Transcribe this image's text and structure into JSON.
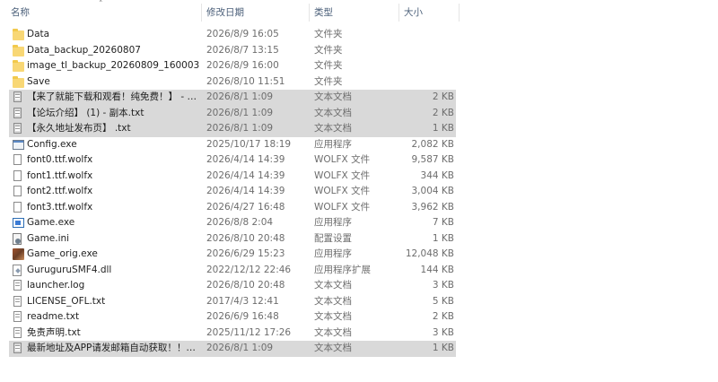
{
  "columns": {
    "name": "名称",
    "date": "修改日期",
    "type": "类型",
    "size": "大小"
  },
  "files": [
    {
      "name": "Data",
      "date": "2026/8/9 16:05",
      "type": "文件夹",
      "size": "",
      "icon": "folder-icon",
      "selected": false
    },
    {
      "name": "Data_backup_20260807",
      "date": "2026/8/7 13:15",
      "type": "文件夹",
      "size": "",
      "icon": "folder-icon",
      "selected": false
    },
    {
      "name": "image_tl_backup_20260809_160003",
      "date": "2026/8/9 16:00",
      "type": "文件夹",
      "size": "",
      "icon": "folder-icon",
      "selected": false
    },
    {
      "name": "Save",
      "date": "2026/8/10 11:51",
      "type": "文件夹",
      "size": "",
      "icon": "folder-icon",
      "selected": false
    },
    {
      "name": "【来了就能下载和观看！纯免费！】 - 副...",
      "date": "2026/8/1 1:09",
      "type": "文本文档",
      "size": "2 KB",
      "icon": "text-document-icon",
      "selected": true
    },
    {
      "name": "【论坛介绍】 (1) - 副本.txt",
      "date": "2026/8/1 1:09",
      "type": "文本文档",
      "size": "2 KB",
      "icon": "text-document-icon",
      "selected": true
    },
    {
      "name": "【永久地址发布页】 .txt",
      "date": "2026/8/1 1:09",
      "type": "文本文档",
      "size": "1 KB",
      "icon": "text-document-icon",
      "selected": true
    },
    {
      "name": "Config.exe",
      "date": "2025/10/17 18:19",
      "type": "应用程序",
      "size": "2,082 KB",
      "icon": "application-icon",
      "selected": false
    },
    {
      "name": "font0.ttf.wolfx",
      "date": "2026/4/14 14:39",
      "type": "WOLFX 文件",
      "size": "9,587 KB",
      "icon": "blank-file-icon",
      "selected": false
    },
    {
      "name": "font1.ttf.wolfx",
      "date": "2026/4/14 14:39",
      "type": "WOLFX 文件",
      "size": "344 KB",
      "icon": "blank-file-icon",
      "selected": false
    },
    {
      "name": "font2.ttf.wolfx",
      "date": "2026/4/14 14:39",
      "type": "WOLFX 文件",
      "size": "3,004 KB",
      "icon": "blank-file-icon",
      "selected": false
    },
    {
      "name": "font3.ttf.wolfx",
      "date": "2026/4/27 16:48",
      "type": "WOLFX 文件",
      "size": "3,962 KB",
      "icon": "blank-file-icon",
      "selected": false
    },
    {
      "name": "Game.exe",
      "date": "2026/8/8 2:04",
      "type": "应用程序",
      "size": "7 KB",
      "icon": "game-app-icon",
      "selected": false
    },
    {
      "name": "Game.ini",
      "date": "2026/8/10 20:48",
      "type": "配置设置",
      "size": "1 KB",
      "icon": "settings-file-icon",
      "selected": false
    },
    {
      "name": "Game_orig.exe",
      "date": "2026/6/29 15:23",
      "type": "应用程序",
      "size": "12,048 KB",
      "icon": "image-app-icon",
      "selected": false
    },
    {
      "name": "GuruguruSMF4.dll",
      "date": "2022/12/12 22:46",
      "type": "应用程序扩展",
      "size": "144 KB",
      "icon": "dll-file-icon",
      "selected": false
    },
    {
      "name": "launcher.log",
      "date": "2026/8/10 20:48",
      "type": "文本文档",
      "size": "3 KB",
      "icon": "text-document-icon",
      "selected": false
    },
    {
      "name": "LICENSE_OFL.txt",
      "date": "2017/4/3 12:41",
      "type": "文本文档",
      "size": "5 KB",
      "icon": "text-document-icon",
      "selected": false
    },
    {
      "name": "readme.txt",
      "date": "2026/6/9 16:48",
      "type": "文本文档",
      "size": "2 KB",
      "icon": "text-document-icon",
      "selected": false
    },
    {
      "name": "免责声明.txt",
      "date": "2025/11/12 17:26",
      "type": "文本文档",
      "size": "3 KB",
      "icon": "text-document-icon",
      "selected": false
    },
    {
      "name": "最新地址及APP请发邮箱自动获取！！！...",
      "date": "2026/8/1 1:09",
      "type": "文本文档",
      "size": "1 KB",
      "icon": "text-document-icon",
      "selected": true
    }
  ]
}
